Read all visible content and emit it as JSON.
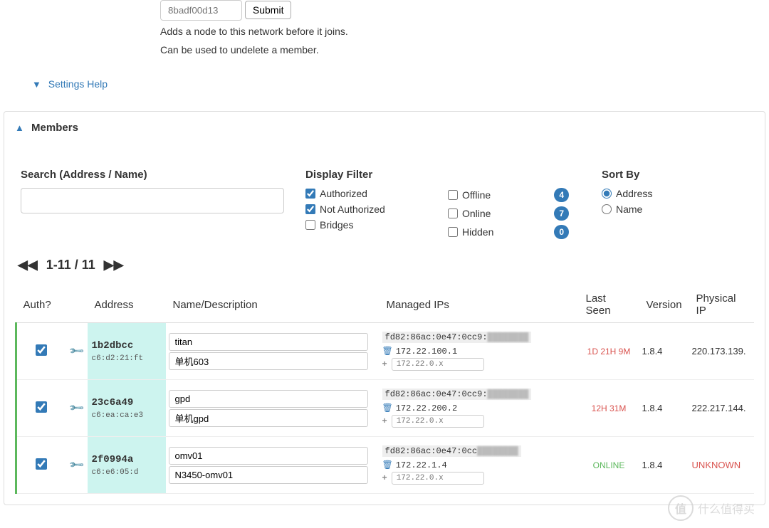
{
  "addNode": {
    "placeholder": "8badf00d13",
    "submitLabel": "Submit",
    "help1": "Adds a node to this network before it joins.",
    "help2": "Can be used to undelete a member."
  },
  "settingsHelp": {
    "label": "Settings Help"
  },
  "membersHeading": "Members",
  "search": {
    "label": "Search (Address / Name)",
    "value": ""
  },
  "displayFilter": {
    "label": "Display Filter",
    "authorized": "Authorized",
    "notAuthorized": "Not Authorized",
    "bridges": "Bridges",
    "offline": "Offline",
    "online": "Online",
    "hidden": "Hidden",
    "counts": {
      "offline": "4",
      "online": "7",
      "hidden": "0"
    }
  },
  "sortBy": {
    "label": "Sort By",
    "address": "Address",
    "name": "Name"
  },
  "pagination": {
    "range": "1-11 / 11"
  },
  "columns": {
    "auth": "Auth?",
    "address": "Address",
    "name": "Name/Description",
    "managedIps": "Managed IPs",
    "lastSeen": "Last Seen",
    "version": "Version",
    "physicalIp": "Physical IP"
  },
  "ipPlaceholder": "172.22.0.x",
  "rows": [
    {
      "addr": "1b2dbcc",
      "mac": "c6:d2:21:ft",
      "name": "titan",
      "desc": "单机603",
      "ipv6": "fd82:86ac:0e47:0cc9:",
      "ipv4": "172.22.100.1",
      "lastSeen": "1D 21H 9M",
      "lastSeenClass": "ls-offline",
      "version": "1.8.4",
      "physIp": "220.173.139.",
      "physClass": ""
    },
    {
      "addr": "23c6a49",
      "mac": "c6:ea:ca:e3",
      "name": "gpd",
      "desc": "单机gpd",
      "ipv6": "fd82:86ac:0e47:0cc9:",
      "ipv4": "172.22.200.2",
      "lastSeen": "12H 31M",
      "lastSeenClass": "ls-offline",
      "version": "1.8.4",
      "physIp": "222.217.144.",
      "physClass": ""
    },
    {
      "addr": "2f0994a",
      "mac": "c6:e6:05:d",
      "name": "omv01",
      "desc": "N3450-omv01",
      "ipv6": "fd82:86ac:0e47:0cc",
      "ipv4": "172.22.1.4",
      "lastSeen": "ONLINE",
      "lastSeenClass": "ls-online",
      "version": "1.8.4",
      "physIp": "UNKNOWN",
      "physClass": "physip-unknown"
    }
  ],
  "watermark": {
    "circle": "值",
    "text": "什么值得买"
  }
}
